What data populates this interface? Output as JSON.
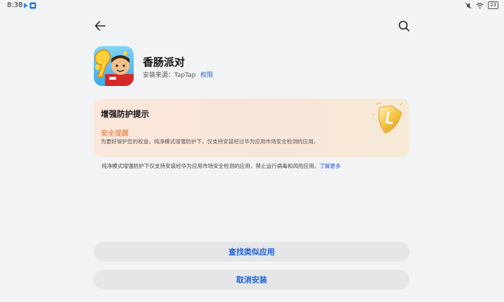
{
  "status_bar": {
    "time": "8:38",
    "battery": "23"
  },
  "header": {
    "back_icon": "arrow-left-icon",
    "search_icon": "search-icon"
  },
  "app": {
    "name": "香肠派对",
    "source_label": "安装来源：TapTap",
    "permissions_link": "权限"
  },
  "warning_card": {
    "title": "增强防护提示",
    "subtitle": "安全提醒",
    "description": "为更好保护您的权益，纯净模式增强防护下，仅支持安装经过华为应用市场安全检测的应用。",
    "accent_color": "#ea6a1e"
  },
  "note": {
    "text": "纯净模式增强防护下仅支持安装经华为应用市场安全检测的应用，禁止运行病毒和风险应用。",
    "learn_more": "了解更多"
  },
  "buttons": {
    "find_similar": "查找类似应用",
    "cancel_install": "取消安装"
  },
  "colors": {
    "link": "#1f5fd6",
    "background": "#f1f3f5",
    "button_bg": "#e5e6e8"
  }
}
